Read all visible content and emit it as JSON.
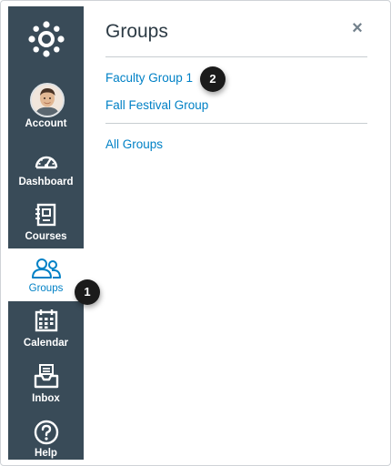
{
  "nav": {
    "account": "Account",
    "dashboard": "Dashboard",
    "courses": "Courses",
    "groups": "Groups",
    "calendar": "Calendar",
    "inbox": "Inbox",
    "help": "Help"
  },
  "tray": {
    "title": "Groups",
    "close_icon": "×",
    "links": [
      "Faculty Group 1",
      "Fall Festival Group"
    ],
    "all_groups": "All Groups"
  },
  "callouts": {
    "one": "1",
    "two": "2"
  },
  "colors": {
    "nav_bg": "#394b58",
    "link": "#0081c6",
    "active": "#0081c6"
  },
  "icons": [
    "canvas-logo-icon",
    "avatar",
    "dashboard-icon",
    "courses-icon",
    "groups-icon",
    "calendar-icon",
    "inbox-icon",
    "help-icon",
    "close-icon"
  ]
}
